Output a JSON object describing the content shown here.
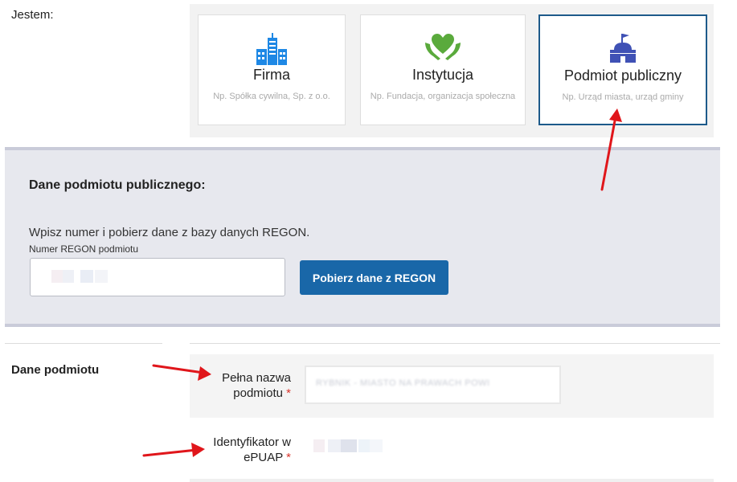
{
  "jestem": {
    "label": "Jestem:",
    "cards": [
      {
        "title": "Firma",
        "desc": "Np. Spółka cywilna, Sp. z o.o.",
        "icon": "buildings-icon",
        "color": "#1e88e5"
      },
      {
        "title": "Instytucja",
        "desc": "Np. Fundacja, organizacja społeczna",
        "icon": "heart-hands-icon",
        "color": "#5aaa3c"
      },
      {
        "title": "Podmiot publiczny",
        "desc": "Np. Urząd miasta, urząd gminy",
        "icon": "public-building-icon",
        "color": "#3f51b5",
        "selected": true
      }
    ]
  },
  "regon_panel": {
    "title": "Dane podmiotu publicznego:",
    "info": "Wpisz numer i pobierz dane z bazy danych REGON.",
    "input_label": "Numer REGON podmiotu",
    "button_label": "Pobierz dane z REGON"
  },
  "dane_podmiotu": {
    "section_label": "Dane podmiotu",
    "full_name_label_1": "Pełna nazwa",
    "full_name_label_2": "podmiotu",
    "full_name_value": "RYBNIK - MIASTO NA PRAWACH POWI",
    "epuap_label_1": "Identyfikator w",
    "epuap_label_2": "ePUAP",
    "required_mark": "*"
  },
  "colors": {
    "accent": "#1967a8",
    "selected_border": "#1d5a8a",
    "arrow": "#e0161b",
    "required": "#d9342b"
  }
}
